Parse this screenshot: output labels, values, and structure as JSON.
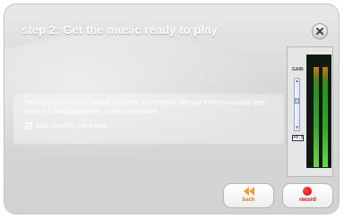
{
  "wizard": {
    "title": "step 2: Get the music ready to play",
    "instructions": {
      "part1": "When you are ready to ",
      "record_word": "record",
      "part2": ", press the record button first and then immediately after, press the ",
      "start_stop_word": "Start/Stop",
      "part3": " button on the audio device."
    },
    "split_option": {
      "label": "Split recording into tracks",
      "checked": true
    }
  },
  "gain": {
    "label": "GAIN",
    "value": "+0.0",
    "slider_level": 0.62
  },
  "meters": {
    "left_level": 0.9,
    "right_level": 0.9
  },
  "buttons": {
    "back_label": "back",
    "record_label": "record"
  },
  "colors": {
    "back_accent": "#d27a12",
    "record_accent": "#d60000"
  }
}
